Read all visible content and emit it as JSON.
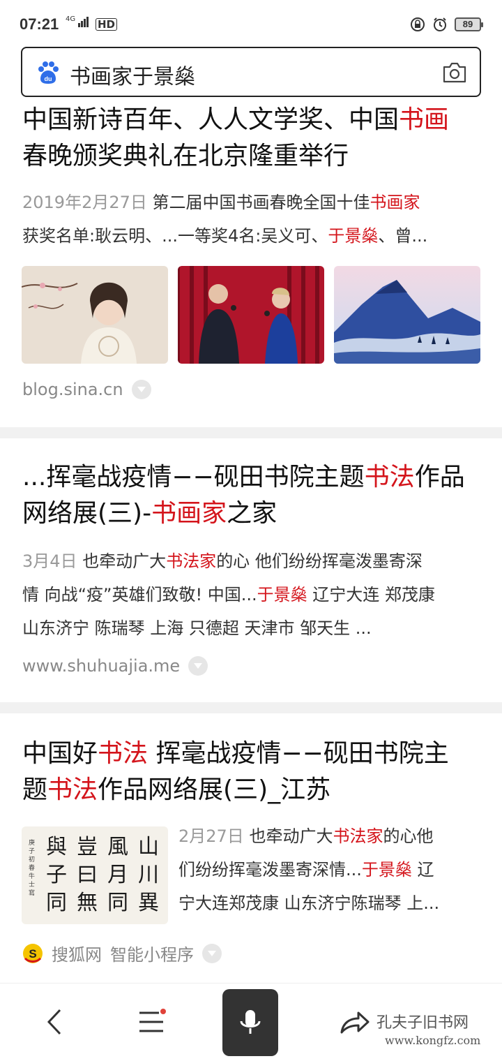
{
  "status_bar": {
    "time": "07:21",
    "network_tag": "4G",
    "hd_label": "HD",
    "battery": "89"
  },
  "search": {
    "query": "书画家于景燊"
  },
  "results": [
    {
      "title_parts": [
        "中国新诗百年、人人文学奖、中国",
        "书画",
        ""
      ],
      "title_line2": "春晚颁奖典礼在北京隆重举行",
      "date": "2019年2月27日",
      "snippet_l1_a": "第二届中国书画春晚全国十佳",
      "snippet_l1_hl": "书画家",
      "snippet_l2_a": "获奖名单:耿云明、...一等奖4名:吴义可、",
      "snippet_l2_hl": "于景燊",
      "snippet_l2_b": "、曾...",
      "source": "blog.sina.cn"
    },
    {
      "title_l1_a": "...挥毫战疫情−−砚田书院主题",
      "title_l1_hl": "书法",
      "title_l1_b": "作品",
      "title_l2_a": "网络展(三)-",
      "title_l2_hl": "书画家",
      "title_l2_b": "之家",
      "date": "3月4日",
      "snippet_l1_a": "也牵动广大",
      "snippet_l1_hl": "书法家",
      "snippet_l1_b": "的心 他们纷纷挥毫泼墨寄深",
      "snippet_l2_a": "情 向战“疫”英雄们致敬! 中国...",
      "snippet_l2_hl": "于景燊",
      "snippet_l2_b": " 辽宁大连 郑茂康",
      "snippet_l3": "山东济宁 陈瑞琴 上海 只德超 天津市 邹天生 ...",
      "source": "www.shuhuajia.me"
    },
    {
      "title_l1_a": "中国好",
      "title_l1_hl": "书法",
      "title_l1_b": " 挥毫战疫情−−砚田书院主",
      "title_l2_a": "题",
      "title_l2_hl": "书法",
      "title_l2_b": "作品网络展(三)_江苏",
      "date": "2月27日",
      "snippet_l1_a": "也牵动广大",
      "snippet_l1_hl": "书法家",
      "snippet_l1_b": "的心他",
      "snippet_l2_a": "们纷纷挥毫泼墨寄深情...",
      "snippet_l2_hl": "于景燊",
      "snippet_l2_b": " 辽",
      "snippet_l3": "宁大连郑茂康 山东济宁陈瑞琴 上...",
      "calligraphy": [
        "山",
        "川",
        "異",
        "風",
        "月",
        "同",
        "豈",
        "曰",
        "無",
        "與",
        "子",
        "同"
      ],
      "calligraphy_small": "庚子初春牛士寫",
      "source": "搜狐网",
      "source_extra": "智能小程序"
    }
  ],
  "bottom_nav": {
    "watermark": "孔夫子旧书网",
    "watermark_url": "www.kongfz.com"
  },
  "colors": {
    "highlight": "#d4141b",
    "baidu_blue": "#2f6ee8"
  }
}
